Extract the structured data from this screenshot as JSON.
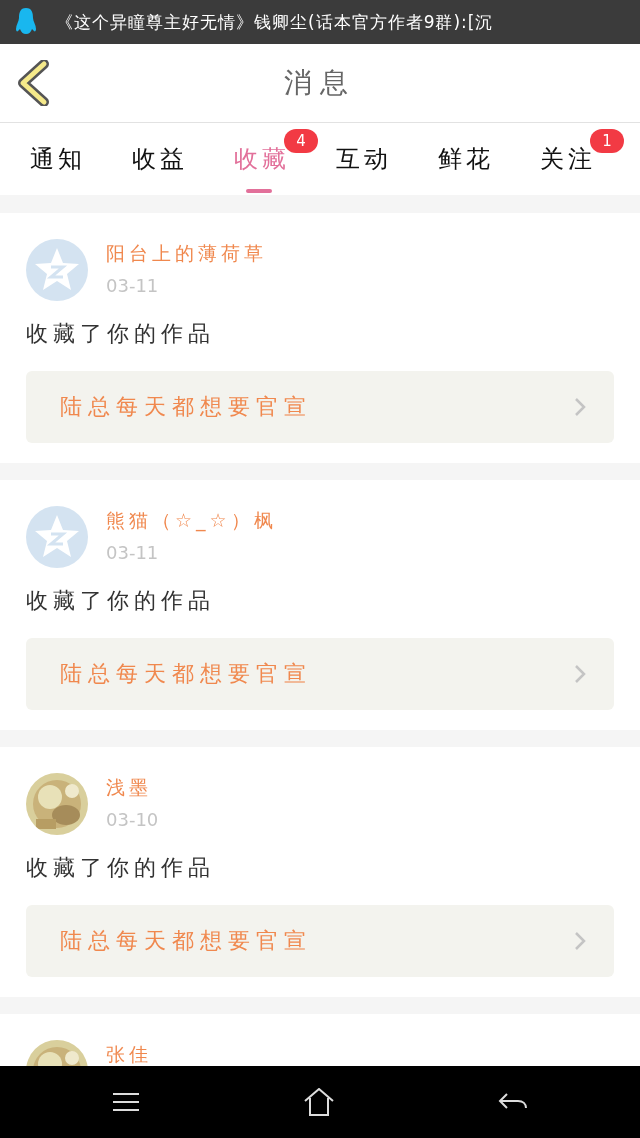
{
  "status_bar": {
    "notification": "《这个异瞳尊主好无情》钱卿尘(话本官方作者9群):[沉"
  },
  "header": {
    "title": "消息"
  },
  "tabs": [
    {
      "label": "通知",
      "selected": false
    },
    {
      "label": "收益",
      "selected": false
    },
    {
      "label": "收藏",
      "selected": true,
      "badge": "4"
    },
    {
      "label": "互动",
      "selected": false
    },
    {
      "label": "鲜花",
      "selected": false
    },
    {
      "label": "关注",
      "selected": false,
      "badge": "1"
    }
  ],
  "messages": [
    {
      "avatar": {
        "kind": "default"
      },
      "name": "阳台上的薄荷草",
      "date": "03-11",
      "action": "收藏了你的作品",
      "work": "陆总每天都想要官宣"
    },
    {
      "avatar": {
        "kind": "default"
      },
      "name": "熊猫（☆_☆）枫",
      "date": "03-11",
      "action": "收藏了你的作品",
      "work": "陆总每天都想要官宣"
    },
    {
      "name": "浅墨",
      "date": "03-10",
      "action": "收藏了你的作品",
      "work": "陆总每天都想要官宣"
    },
    {
      "name": "张佳"
    }
  ]
}
